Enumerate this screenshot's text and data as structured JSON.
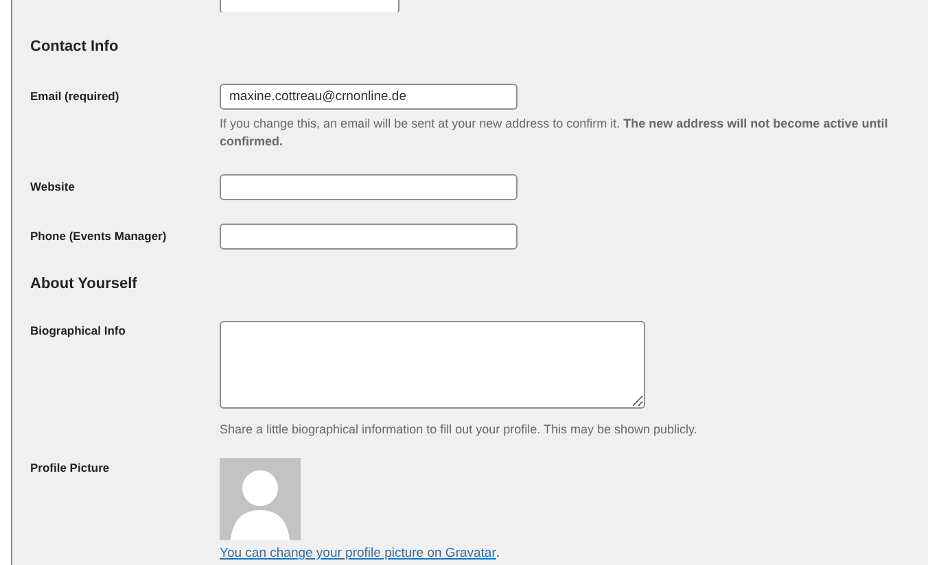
{
  "top_field": {
    "kind": "input"
  },
  "sections": [
    {
      "heading": "Contact Info",
      "rows": [
        {
          "kind": "input",
          "label": "Email (required)",
          "value": "maxine.cottreau@crnonline.de",
          "help": "If you change this, an email will be sent at your new address to confirm it. **The new address will not become active until confirmed.**"
        },
        {
          "kind": "input",
          "label": "Website"
        },
        {
          "kind": "input",
          "label": "Phone (Events Manager)"
        }
      ]
    },
    {
      "heading": "About Yourself",
      "rows": [
        {
          "kind": "textarea",
          "label": "Biographical Info",
          "help": "Share a little biographical information to fill out your profile. This may be shown publicly."
        },
        {
          "kind": "avatar",
          "label": "Profile Picture",
          "link": "You can change your profile picture on Gravatar",
          "after": "."
        }
      ]
    }
  ]
}
